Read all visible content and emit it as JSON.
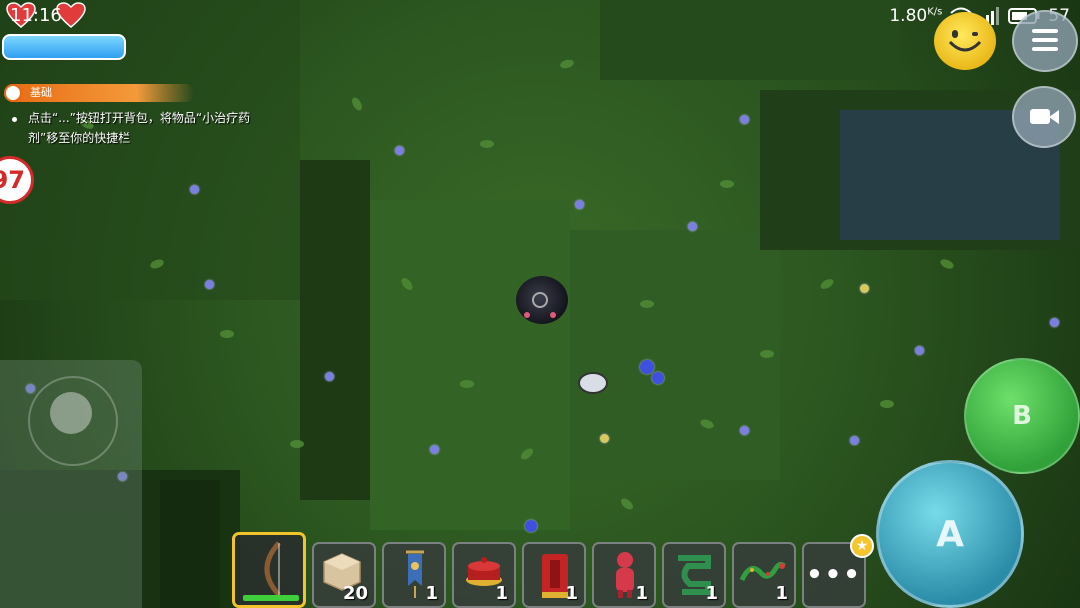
{
  "status_bar": {
    "time": "11:16",
    "network_speed": "1.80",
    "network_unit": "K/s",
    "battery": "57"
  },
  "player": {
    "hearts": 2,
    "health_fraction": 1.0
  },
  "quest": {
    "category": "基础",
    "text": "点击“...”按钮打开背包，将物品“小治疗药剂”移至你的快捷栏"
  },
  "side_badge": {
    "value": "97"
  },
  "controls": {
    "b_label": "B",
    "a_label": "A"
  },
  "hotbar": {
    "slots": [
      {
        "item": "bow",
        "count": "",
        "selected": true
      },
      {
        "item": "sand-block",
        "count": "20"
      },
      {
        "item": "banner",
        "count": "1"
      },
      {
        "item": "red-cake",
        "count": "1"
      },
      {
        "item": "red-armor",
        "count": "1"
      },
      {
        "item": "red-doll",
        "count": "1"
      },
      {
        "item": "green-item",
        "count": "1"
      },
      {
        "item": "dragon-item",
        "count": "1"
      }
    ],
    "more_label": "•••"
  },
  "colors": {
    "grass": "#2c5720",
    "health": "#2e9ff0",
    "quest_tag": "#e86a12",
    "button_b": "#31a23a",
    "button_a": "#2b8ca8",
    "selected_slot": "#f0c42a"
  }
}
